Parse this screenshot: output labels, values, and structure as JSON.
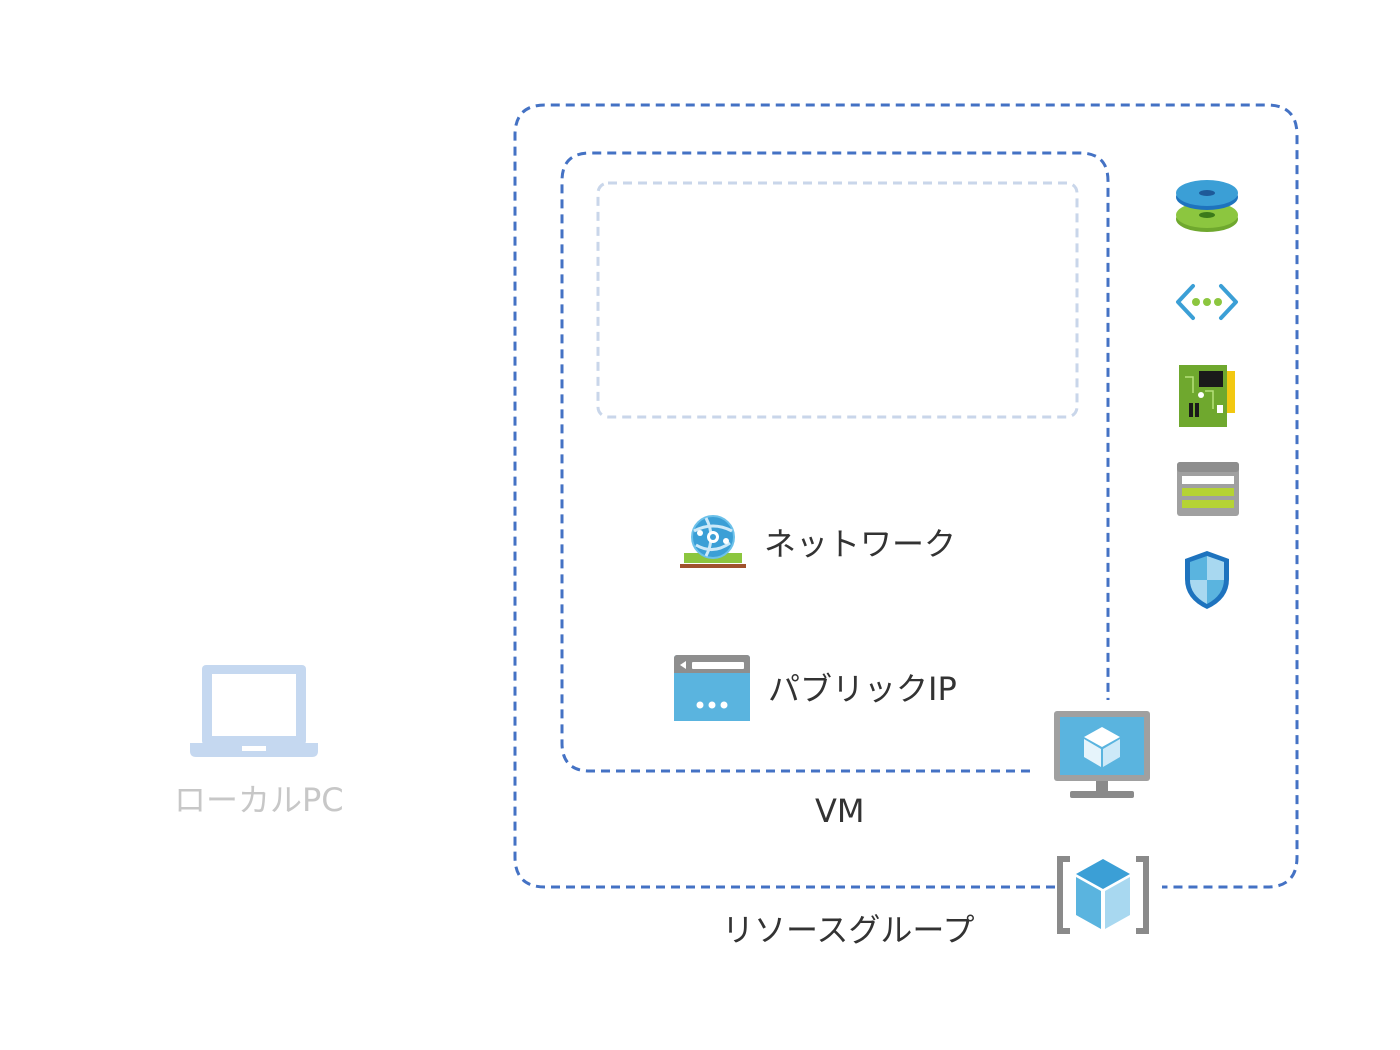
{
  "labels": {
    "local_pc": "ローカルPC",
    "network": "ネットワーク",
    "public_ip": "パブリックIP",
    "vm": "VM",
    "resource_group": "リソースグループ"
  },
  "colors": {
    "dashed_border": "#4472c4",
    "inner_placeholder_border": "#c9d6ea",
    "laptop_icon": "#c5d8f0",
    "local_pc_text": "#c7c7c7",
    "text": "#333333",
    "azure_blue": "#3b9fd6",
    "azure_green": "#8cc63f"
  },
  "icons": {
    "local_pc": "laptop-icon",
    "network": "virtual-network-globe-icon",
    "public_ip": "public-ip-window-icon",
    "vm": "virtual-machine-monitor-icon",
    "resource_group": "resource-group-cube-icon",
    "side": [
      "disk-icon",
      "network-connection-icon",
      "network-interface-card-icon",
      "storage-account-icon",
      "network-security-group-shield-icon"
    ]
  }
}
